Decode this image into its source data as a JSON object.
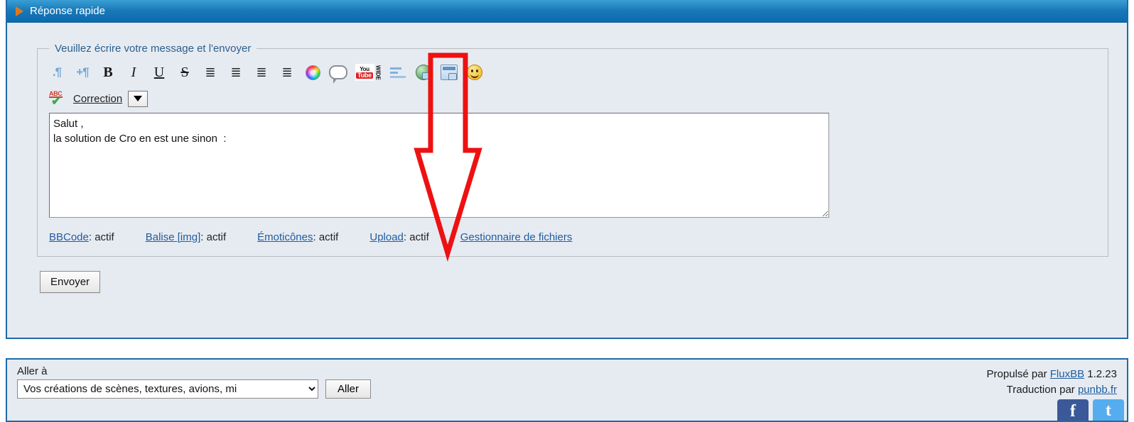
{
  "panel": {
    "title": "Réponse rapide",
    "arrow_icon": "play-triangle-icon"
  },
  "form": {
    "legend": "Veuillez écrire votre message et l'envoyer",
    "toolbar": [
      {
        "name": "outdent-icon",
        "label": "-¶"
      },
      {
        "name": "indent-icon",
        "label": "+¶"
      },
      {
        "name": "bold-icon",
        "label": "B"
      },
      {
        "name": "italic-icon",
        "label": "I"
      },
      {
        "name": "underline-icon",
        "label": "U"
      },
      {
        "name": "strikethrough-icon",
        "label": "S"
      },
      {
        "name": "align-left-icon",
        "label": "≡"
      },
      {
        "name": "align-center-icon",
        "label": "≡"
      },
      {
        "name": "align-right-icon",
        "label": "≡"
      },
      {
        "name": "align-justify-icon",
        "label": "≡"
      },
      {
        "name": "text-color-icon",
        "label": ""
      },
      {
        "name": "quote-icon",
        "label": ""
      },
      {
        "name": "youtube-icon",
        "label": "YouTube WIDE"
      },
      {
        "name": "list-icon",
        "label": ""
      },
      {
        "name": "link-icon",
        "label": ""
      },
      {
        "name": "image-icon",
        "label": ""
      },
      {
        "name": "smiley-icon",
        "label": ""
      }
    ],
    "spellcheck": {
      "icon": "abc-spellcheck-icon",
      "abc_text": "ABC",
      "label": "Correction",
      "dropdown_name": "spellcheck-dropdown"
    },
    "message": {
      "value": "Salut ,\nla solution de Cro en est une sinon  :",
      "placeholder": ""
    },
    "info_links": [
      {
        "link": "BBCode",
        "status": ": actif"
      },
      {
        "link": "Balise [img]",
        "status": ": actif"
      },
      {
        "link": "Émoticônes",
        "status": ": actif"
      },
      {
        "link": "Upload",
        "status": ": actif"
      },
      {
        "link": "Gestionnaire de fichiers",
        "status": ""
      }
    ],
    "submit_label": "Envoyer"
  },
  "footer": {
    "goto_label": "Aller à",
    "goto_selected": "Vos créations de scènes, textures, avions, mi",
    "goto_button": "Aller",
    "powered_prefix": "Propulsé par ",
    "powered_link": "FluxBB",
    "powered_version": " 1.2.23",
    "translation_prefix": "Traduction par ",
    "translation_link": "punbb.fr",
    "social": [
      {
        "name": "facebook-icon"
      },
      {
        "name": "twitter-icon"
      }
    ]
  },
  "annotation": {
    "color": "#ee1111",
    "name": "red-arrow-annotation",
    "points_to": "Upload"
  }
}
